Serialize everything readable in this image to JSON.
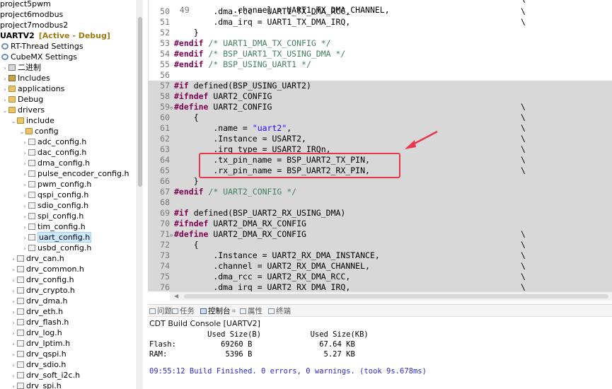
{
  "tree": {
    "items": [
      {
        "label": "project5pwm",
        "kind": "project",
        "arrow": ""
      },
      {
        "label": "project6modbus",
        "kind": "project",
        "arrow": ""
      },
      {
        "label": "project7modbus2",
        "kind": "project",
        "arrow": ""
      },
      {
        "label": "UARTV2",
        "kind": "project",
        "arrow": "",
        "tag": "[Active - Debug]"
      },
      {
        "label": "RT-Thread Settings",
        "kind": "gear",
        "arrow": ""
      },
      {
        "label": "CubeMX Settings",
        "kind": "gear",
        "arrow": ""
      },
      {
        "label": "二进制",
        "kind": "bin",
        "arrow": "›"
      },
      {
        "label": "Includes",
        "kind": "inc",
        "arrow": "›"
      },
      {
        "label": "applications",
        "kind": "folder",
        "arrow": "›"
      },
      {
        "label": "Debug",
        "kind": "folder",
        "arrow": "›"
      },
      {
        "label": "drivers",
        "kind": "folder",
        "arrow": "⌄"
      },
      {
        "label": "include",
        "kind": "folder",
        "arrow": "⌄"
      },
      {
        "label": "config",
        "kind": "folder",
        "arrow": "⌄"
      },
      {
        "label": "adc_config.h",
        "kind": "file",
        "arrow": "›"
      },
      {
        "label": "dac_config.h",
        "kind": "file",
        "arrow": "›"
      },
      {
        "label": "dma_config.h",
        "kind": "file",
        "arrow": "›"
      },
      {
        "label": "pulse_encoder_config.h",
        "kind": "file",
        "arrow": "›"
      },
      {
        "label": "pwm_config.h",
        "kind": "file",
        "arrow": "›"
      },
      {
        "label": "qspi_config.h",
        "kind": "file",
        "arrow": "›"
      },
      {
        "label": "sdio_config.h",
        "kind": "file",
        "arrow": "›"
      },
      {
        "label": "spi_config.h",
        "kind": "file",
        "arrow": "›"
      },
      {
        "label": "tim_config.h",
        "kind": "file",
        "arrow": "›"
      },
      {
        "label": "uart_config.h",
        "kind": "file",
        "arrow": "›",
        "selected": true
      },
      {
        "label": "usbd_config.h",
        "kind": "file",
        "arrow": "›"
      },
      {
        "label": "drv_can.h",
        "kind": "file",
        "arrow": "›"
      },
      {
        "label": "drv_common.h",
        "kind": "file",
        "arrow": "›"
      },
      {
        "label": "drv_config.h",
        "kind": "file",
        "arrow": "›"
      },
      {
        "label": "drv_crypto.h",
        "kind": "file",
        "arrow": "›"
      },
      {
        "label": "drv_dma.h",
        "kind": "file",
        "arrow": "›"
      },
      {
        "label": "drv_eth.h",
        "kind": "file",
        "arrow": "›"
      },
      {
        "label": "drv_flash.h",
        "kind": "file",
        "arrow": "›"
      },
      {
        "label": "drv_log.h",
        "kind": "file",
        "arrow": "›"
      },
      {
        "label": "drv_lptim.h",
        "kind": "file",
        "arrow": "›"
      },
      {
        "label": "drv_qspi.h",
        "kind": "file",
        "arrow": "›"
      },
      {
        "label": "drv_sdio.h",
        "kind": "file",
        "arrow": "›"
      },
      {
        "label": "drv_soft_i2c.h",
        "kind": "file",
        "arrow": "›"
      },
      {
        "label": "drv_spi.h",
        "kind": "file",
        "arrow": "›"
      }
    ]
  },
  "editor": {
    "lines": [
      {
        "n": "50",
        "code": [
          {
            "t": "        .dma_rcc = UART1_TX_DMA_RCC,"
          }
        ],
        "bs": true,
        "inactive": false
      },
      {
        "n": "51",
        "code": [
          {
            "t": "        .dma_irq = UART1_TX_DMA_IRQ,"
          }
        ],
        "bs": true,
        "inactive": false
      },
      {
        "n": "52",
        "code": [
          {
            "t": "    }"
          }
        ],
        "bs": false,
        "inactive": false
      },
      {
        "n": "53",
        "code": [
          {
            "t": "#endif",
            "c": "kw"
          },
          {
            "t": " /* UART1_DMA_TX_CONFIG */",
            "c": "cm"
          }
        ],
        "bs": false,
        "inactive": false
      },
      {
        "n": "54",
        "code": [
          {
            "t": "#endif",
            "c": "kw"
          },
          {
            "t": " /* BSP_UART1_TX_USING_DMA */",
            "c": "cm"
          }
        ],
        "bs": false,
        "inactive": false
      },
      {
        "n": "55",
        "code": [
          {
            "t": "#endif",
            "c": "kw"
          },
          {
            "t": " /* BSP_USING_UART1 */",
            "c": "cm"
          }
        ],
        "bs": false,
        "inactive": false
      },
      {
        "n": "56",
        "code": [
          {
            "t": ""
          }
        ],
        "bs": false,
        "inactive": false
      },
      {
        "n": "57",
        "code": [
          {
            "t": "#if",
            "c": "kw"
          },
          {
            "t": " defined(BSP_USING_UART2)"
          }
        ],
        "bs": false,
        "inactive": true
      },
      {
        "n": "58",
        "code": [
          {
            "t": "#ifndef",
            "c": "kw"
          },
          {
            "t": " UART2_CONFIG"
          }
        ],
        "bs": false,
        "inactive": true
      },
      {
        "n": "59",
        "fold": true,
        "code": [
          {
            "t": "#define",
            "c": "kw"
          },
          {
            "t": " UART2_CONFIG"
          }
        ],
        "bs": true,
        "inactive": true
      },
      {
        "n": "60",
        "code": [
          {
            "t": "    {"
          }
        ],
        "bs": true,
        "inactive": true
      },
      {
        "n": "61",
        "code": [
          {
            "t": "        .name = "
          },
          {
            "t": "\"uart2\"",
            "c": "st"
          },
          {
            "t": ","
          }
        ],
        "bs": true,
        "inactive": true
      },
      {
        "n": "62",
        "code": [
          {
            "t": "        .Instance = USART2,"
          }
        ],
        "bs": true,
        "inactive": true
      },
      {
        "n": "63",
        "code": [
          {
            "t": "        .irq_type = USART2_IRQn,"
          }
        ],
        "bs": true,
        "inactive": true
      },
      {
        "n": "64",
        "code": [
          {
            "t": "        .tx_pin_name = BSP_UART2_TX_PIN,"
          }
        ],
        "bs": true,
        "inactive": true
      },
      {
        "n": "65",
        "code": [
          {
            "t": "        .rx_pin_name = BSP_UART2_RX_PIN,"
          }
        ],
        "bs": true,
        "inactive": true
      },
      {
        "n": "66",
        "code": [
          {
            "t": "    }"
          }
        ],
        "bs": false,
        "inactive": true
      },
      {
        "n": "67",
        "code": [
          {
            "t": "#endif",
            "c": "kw"
          },
          {
            "t": " /* UART2_CONFIG */",
            "c": "cm"
          }
        ],
        "bs": false,
        "inactive": true
      },
      {
        "n": "68",
        "code": [
          {
            "t": ""
          }
        ],
        "bs": false,
        "inactive": true
      },
      {
        "n": "69",
        "code": [
          {
            "t": "#if",
            "c": "kw"
          },
          {
            "t": " defined(BSP_UART2_RX_USING_DMA)"
          }
        ],
        "bs": false,
        "inactive": true
      },
      {
        "n": "70",
        "code": [
          {
            "t": "#ifndef",
            "c": "kw"
          },
          {
            "t": " UART2_DMA_RX_CONFIG"
          }
        ],
        "bs": false,
        "inactive": true
      },
      {
        "n": "71",
        "fold": true,
        "code": [
          {
            "t": "#define",
            "c": "kw"
          },
          {
            "t": " UART2_DMA_RX_CONFIG"
          }
        ],
        "bs": true,
        "inactive": true
      },
      {
        "n": "72",
        "code": [
          {
            "t": "    {"
          }
        ],
        "bs": true,
        "inactive": true
      },
      {
        "n": "73",
        "code": [
          {
            "t": "        .Instance = UART2_RX_DMA_INSTANCE,"
          }
        ],
        "bs": true,
        "inactive": true
      },
      {
        "n": "74",
        "code": [
          {
            "t": "        .channel = UART2_RX_DMA_CHANNEL,"
          }
        ],
        "bs": true,
        "inactive": true
      },
      {
        "n": "75",
        "code": [
          {
            "t": "        .dma_rcc = UART2_RX_DMA_RCC,"
          }
        ],
        "bs": true,
        "inactive": true
      },
      {
        "n": "76",
        "code": [
          {
            "t": "        .dma_irq = UART2_RX_DMA_IRQ,"
          }
        ],
        "bs": true,
        "inactive": true
      }
    ],
    "partial_top_line": "        .channel = UART1_TX_DMA_CHANNEL,",
    "partial_top_num": "49",
    "backslash": "\\"
  },
  "panel": {
    "tabs": [
      {
        "label": "问题",
        "active": false
      },
      {
        "label": "任务",
        "active": false
      },
      {
        "label": "控制台",
        "active": true
      },
      {
        "label": "属性",
        "active": false
      },
      {
        "label": "终端",
        "active": false
      }
    ],
    "close_glyph": "⌗",
    "console_title": "CDT Build Console [UARTV2]",
    "size_header": "             Used Size(B)           Used Size(KB)",
    "flash_row": "Flash:          69260 B               67.64 KB",
    "ram_row": "RAM:             5396 B                5.27 KB",
    "build_msg": "09:55:12 Build Finished. 0 errors, 0 warnings. (took 9s.678ms)"
  },
  "colors": {
    "keyword": "#7f0055",
    "comment": "#3f7f5f",
    "string": "#2a00ff",
    "inactive_bg": "#d8d8d8",
    "annotation": "#e8374a"
  }
}
